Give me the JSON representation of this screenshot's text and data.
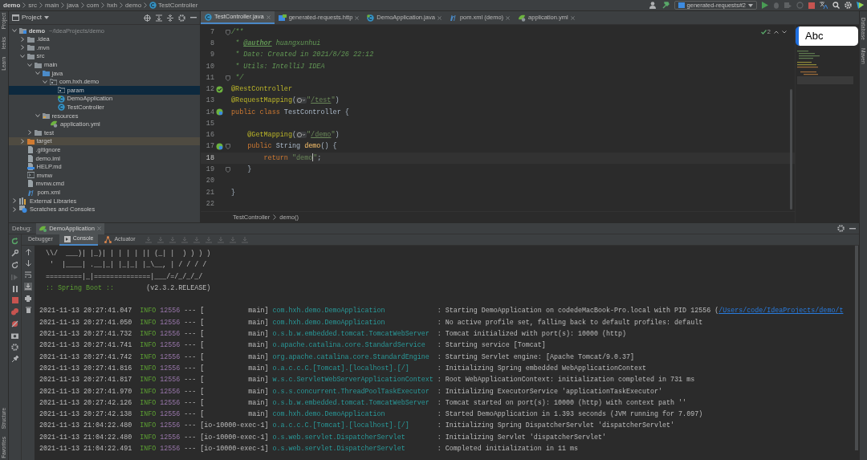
{
  "breadcrumbs": [
    {
      "label": "demo",
      "kind": "module"
    },
    {
      "label": "src",
      "kind": "plain"
    },
    {
      "label": "main",
      "kind": "plain"
    },
    {
      "label": "java",
      "kind": "plain"
    },
    {
      "label": "com",
      "kind": "plain"
    },
    {
      "label": "hxh",
      "kind": "plain"
    },
    {
      "label": "demo",
      "kind": "plain"
    },
    {
      "label": "TestController",
      "kind": "class"
    }
  ],
  "run_configuration": {
    "label": "generated-requests#2"
  },
  "side_strip_left": {
    "top": [
      "Project",
      "leeks",
      "Learn"
    ],
    "bottom": [
      "Structure",
      "Favorites"
    ]
  },
  "side_strip_right": [
    "Database",
    "Maven"
  ],
  "project_panel": {
    "title": "Project",
    "tree": [
      {
        "label": "demo",
        "suffix": "~/IdeaProjects/demo",
        "kind": "module",
        "expanded": true,
        "selected": false,
        "excluded": false,
        "children": [
          {
            "label": ".idea",
            "kind": "folder",
            "expanded": false,
            "selected": false,
            "excluded": false
          },
          {
            "label": ".mvn",
            "kind": "folder",
            "expanded": false,
            "selected": false,
            "excluded": false
          },
          {
            "label": "src",
            "kind": "folder",
            "expanded": true,
            "selected": false,
            "excluded": false,
            "children": [
              {
                "label": "main",
                "kind": "folder",
                "expanded": true,
                "selected": false,
                "excluded": false,
                "children": [
                  {
                    "label": "java",
                    "kind": "source_folder",
                    "expanded": true,
                    "selected": false,
                    "excluded": false,
                    "children": [
                      {
                        "label": "com.hxh.demo",
                        "kind": "package",
                        "expanded": true,
                        "selected": false,
                        "excluded": false,
                        "children": [
                          {
                            "label": "param",
                            "kind": "package",
                            "selected": true,
                            "excluded": false
                          },
                          {
                            "label": "DemoApplication",
                            "kind": "spring_class",
                            "selected": false,
                            "excluded": false
                          },
                          {
                            "label": "TestController",
                            "kind": "class",
                            "selected": false,
                            "excluded": false
                          }
                        ]
                      }
                    ]
                  },
                  {
                    "label": "resources",
                    "kind": "resources_folder",
                    "expanded": true,
                    "selected": false,
                    "excluded": false,
                    "children": [
                      {
                        "label": "application.yml",
                        "kind": "yml",
                        "selected": false,
                        "excluded": false
                      }
                    ]
                  }
                ]
              },
              {
                "label": "test",
                "kind": "folder",
                "expanded": false,
                "selected": false,
                "excluded": false
              }
            ]
          },
          {
            "label": "target",
            "kind": "excluded_folder",
            "expanded": false,
            "selected": false,
            "excluded": true
          },
          {
            "label": ".gitignore",
            "kind": "file",
            "selected": false,
            "excluded": false
          },
          {
            "label": "demo.iml",
            "kind": "file",
            "selected": false,
            "excluded": false
          },
          {
            "label": "HELP.md",
            "kind": "markdown",
            "selected": false,
            "excluded": false
          },
          {
            "label": "mvnw",
            "kind": "script",
            "selected": false,
            "excluded": false
          },
          {
            "label": "mvnw.cmd",
            "kind": "file",
            "selected": false,
            "excluded": false
          },
          {
            "label": "pom.xml",
            "kind": "maven",
            "selected": false,
            "excluded": false
          }
        ]
      },
      {
        "label": "External Libraries",
        "kind": "library",
        "expanded": false,
        "selected": false,
        "excluded": false
      },
      {
        "label": "Scratches and Consoles",
        "kind": "scratches",
        "expanded": false,
        "selected": false,
        "excluded": false
      }
    ]
  },
  "editor_tabs": [
    {
      "label": "TestController.java",
      "kind": "class",
      "selected": true
    },
    {
      "label": "generated-requests.http",
      "kind": "http",
      "selected": false
    },
    {
      "label": "DemoApplication.java",
      "kind": "spring_class",
      "selected": false
    },
    {
      "label": "pom.xml (demo)",
      "kind": "maven",
      "selected": false
    },
    {
      "label": "application.yml",
      "kind": "yml",
      "selected": false
    }
  ],
  "inspection_count": "2",
  "code_lines": [
    {
      "number": "7",
      "fold": true,
      "current": false,
      "segments": [
        {
          "kind": "doc",
          "text": "/**"
        }
      ]
    },
    {
      "number": "8",
      "fold": false,
      "current": false,
      "segments": [
        {
          "kind": "doc",
          "text": " * "
        },
        {
          "kind": "doctag",
          "text": "@author"
        },
        {
          "kind": "doc",
          "text": " huangxunhui"
        }
      ]
    },
    {
      "number": "9",
      "fold": false,
      "current": false,
      "segments": [
        {
          "kind": "doc",
          "text": " * Date: Created in 2021/8/26 22:12"
        }
      ]
    },
    {
      "number": "10",
      "fold": false,
      "current": false,
      "segments": [
        {
          "kind": "doc",
          "text": " * Utils: IntelliJ IDEA"
        }
      ]
    },
    {
      "number": "11",
      "fold": true,
      "current": false,
      "segments": [
        {
          "kind": "doc",
          "text": " */"
        }
      ]
    },
    {
      "number": "12",
      "fold": false,
      "current": false,
      "gutter": {
        "kind": "bean"
      },
      "segments": [
        {
          "kind": "annotation",
          "text": "@RestController"
        }
      ]
    },
    {
      "number": "13",
      "fold": false,
      "current": false,
      "segments": [
        {
          "kind": "annotation",
          "text": "@RequestMapping"
        },
        {
          "kind": "plain",
          "text": "("
        },
        {
          "kind": "inlay"
        },
        {
          "kind": "string",
          "text": "\""
        },
        {
          "kind": "url",
          "text": "/test"
        },
        {
          "kind": "string",
          "text": "\""
        },
        {
          "kind": "plain",
          "text": ")"
        }
      ]
    },
    {
      "number": "14",
      "fold": false,
      "current": false,
      "gutter": {
        "kind": "endpoint"
      },
      "segments": [
        {
          "kind": "keyword",
          "text": "public class "
        },
        {
          "kind": "plain",
          "text": "TestController {"
        }
      ]
    },
    {
      "number": "15",
      "fold": false,
      "current": false
    },
    {
      "number": "16",
      "fold": false,
      "current": false,
      "segments": [
        {
          "kind": "annotation",
          "text": "    @GetMapping"
        },
        {
          "kind": "plain",
          "text": "("
        },
        {
          "kind": "inlay"
        },
        {
          "kind": "string",
          "text": "\""
        },
        {
          "kind": "url",
          "text": "/demo"
        },
        {
          "kind": "string",
          "text": "\""
        },
        {
          "kind": "plain",
          "text": ")"
        }
      ]
    },
    {
      "number": "17",
      "fold": true,
      "current": false,
      "gutter": {
        "kind": "endpoint"
      },
      "segments": [
        {
          "kind": "keyword",
          "text": "    public "
        },
        {
          "kind": "plain",
          "text": "String "
        },
        {
          "kind": "method",
          "text": "demo"
        },
        {
          "kind": "plain",
          "text": "() {"
        }
      ]
    },
    {
      "number": "18",
      "fold": false,
      "current": true,
      "segments": [
        {
          "kind": "keyword",
          "text": "        return "
        },
        {
          "kind": "string",
          "text": "\"demo"
        },
        {
          "kind": "caret"
        },
        {
          "kind": "string",
          "text": "\""
        },
        {
          "kind": "plain",
          "text": ";"
        }
      ]
    },
    {
      "number": "19",
      "fold": true,
      "current": false,
      "segments": [
        {
          "kind": "plain",
          "text": "    }"
        }
      ]
    },
    {
      "number": "20",
      "fold": false,
      "current": false
    },
    {
      "number": "21",
      "fold": false,
      "current": false,
      "segments": [
        {
          "kind": "plain",
          "text": "}"
        }
      ]
    },
    {
      "number": "22",
      "fold": false,
      "current": false
    }
  ],
  "editor_breadcrumbs": [
    "TestController",
    "demo()"
  ],
  "input_source_indicator": "Abc",
  "debug": {
    "label": "Debug:",
    "session_tab": "DemoApplication",
    "tabs": [
      {
        "label": "Debugger",
        "kind": "plain",
        "selected": false
      },
      {
        "label": "Console",
        "kind": "console",
        "selected": true
      },
      {
        "label": "Actuator",
        "kind": "actuator",
        "selected": false
      }
    ],
    "banner": [
      " \\\\/  ___)| |_)| | | | | || (_| |  ) ) ) )",
      "  '  |____| .__|_| |_|_| |_\\__, | / / / /",
      " =========|_|==============|___/=/_/_/_/"
    ],
    "boot_line": {
      "label": " :: Spring Boot :: ",
      "version": "       (v2.3.2.RELEASE)"
    },
    "log": [
      {
        "time": "2021-11-13 20:27:41.047",
        "level": "INFO",
        "pid": "12556",
        "sep": "---",
        "thread": "[           main]",
        "logger": "com.hxh.demo.DemoApplication",
        "message": ": Starting DemoApplication on codedeMacBook-Pro.local with PID 12556 (",
        "link": "/Users/code/IdeaProjects/demo/t"
      },
      {
        "time": "2021-11-13 20:27:41.050",
        "level": "INFO",
        "pid": "12556",
        "sep": "---",
        "thread": "[           main]",
        "logger": "com.hxh.demo.DemoApplication",
        "message": ": No active profile set, falling back to default profiles: default"
      },
      {
        "time": "2021-11-13 20:27:41.732",
        "level": "INFO",
        "pid": "12556",
        "sep": "---",
        "thread": "[           main]",
        "logger": "o.s.b.w.embedded.tomcat.TomcatWebServer",
        "message": ": Tomcat initialized with port(s): 10000 (http)"
      },
      {
        "time": "2021-11-13 20:27:41.741",
        "level": "INFO",
        "pid": "12556",
        "sep": "---",
        "thread": "[           main]",
        "logger": "o.apache.catalina.core.StandardService",
        "message": ": Starting service [Tomcat]"
      },
      {
        "time": "2021-11-13 20:27:41.742",
        "level": "INFO",
        "pid": "12556",
        "sep": "---",
        "thread": "[           main]",
        "logger": "org.apache.catalina.core.StandardEngine",
        "message": ": Starting Servlet engine: [Apache Tomcat/9.0.37]"
      },
      {
        "time": "2021-11-13 20:27:41.816",
        "level": "INFO",
        "pid": "12556",
        "sep": "---",
        "thread": "[           main]",
        "logger": "o.a.c.c.C.[Tomcat].[localhost].[/]",
        "message": ": Initializing Spring embedded WebApplicationContext"
      },
      {
        "time": "2021-11-13 20:27:41.817",
        "level": "INFO",
        "pid": "12556",
        "sep": "---",
        "thread": "[           main]",
        "logger": "w.s.c.ServletWebServerApplicationContext",
        "message": ": Root WebApplicationContext: initialization completed in 731 ms"
      },
      {
        "time": "2021-11-13 20:27:41.970",
        "level": "INFO",
        "pid": "12556",
        "sep": "---",
        "thread": "[           main]",
        "logger": "o.s.s.concurrent.ThreadPoolTaskExecutor",
        "message": ": Initializing ExecutorService 'applicationTaskExecutor'"
      },
      {
        "time": "2021-11-13 20:27:42.126",
        "level": "INFO",
        "pid": "12556",
        "sep": "---",
        "thread": "[           main]",
        "logger": "o.s.b.w.embedded.tomcat.TomcatWebServer",
        "message": ": Tomcat started on port(s): 10000 (http) with context path ''"
      },
      {
        "time": "2021-11-13 20:27:42.138",
        "level": "INFO",
        "pid": "12556",
        "sep": "---",
        "thread": "[           main]",
        "logger": "com.hxh.demo.DemoApplication",
        "message": ": Started DemoApplication in 1.393 seconds (JVM running for 7.097)"
      },
      {
        "time": "2021-11-13 21:04:22.480",
        "level": "INFO",
        "pid": "12556",
        "sep": "---",
        "thread": "[io-10000-exec-1]",
        "logger": "o.a.c.c.C.[Tomcat].[localhost].[/]",
        "message": ": Initializing Spring DispatcherServlet 'dispatcherServlet'"
      },
      {
        "time": "2021-11-13 21:04:22.480",
        "level": "INFO",
        "pid": "12556",
        "sep": "---",
        "thread": "[io-10000-exec-1]",
        "logger": "o.s.web.servlet.DispatcherServlet",
        "message": ": Initializing Servlet 'dispatcherServlet'"
      },
      {
        "time": "2021-11-13 21:04:22.491",
        "level": "INFO",
        "pid": "12556",
        "sep": "---",
        "thread": "[io-10000-exec-1]",
        "logger": "o.s.web.servlet.DispatcherServlet",
        "message": ": Completed initialization in 11 ms"
      }
    ]
  }
}
